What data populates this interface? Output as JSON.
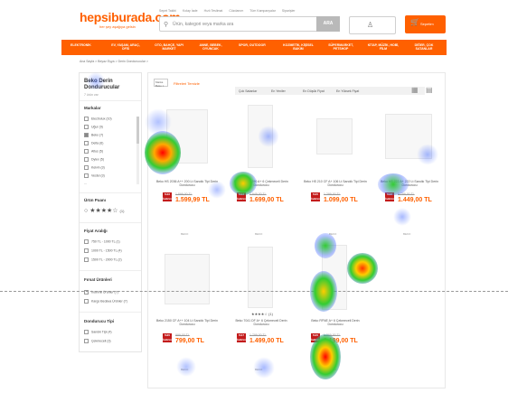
{
  "header": {
    "logo": "hepsiburada.com",
    "slogan": "her şey aşağıya gelsin",
    "top_links": [
      "Sepet Takibi",
      "Kolay İade",
      "Hızlı Teslimat",
      "Cüzdanım",
      "Tüm Kampanyalar",
      "Siparişler"
    ],
    "search_placeholder": "Ürün, kategori veya marka ara",
    "search_button": "ARA",
    "account_icon": "user-icon",
    "cart_label": "Sepetim"
  },
  "categories": [
    "ELEKTRONİK",
    "EV, YAŞAM, ARAÇ, OFİS",
    "OTO, BAHÇE, YAPI MARKET",
    "ANNE, BEBEK, OYUNCAK",
    "SPOR, OUTDOOR",
    "KOZMETİK, KİŞİSEL BAKIM",
    "SÜPERMARKET, PETSHOP",
    "KİTAP, MÜZİK, HOBİ, FİLM",
    "DİĞER, ÇOK SATANLAR"
  ],
  "breadcrumb": "Ana Sayfa > Beyaz Eşya > Derin Dondurucular >",
  "sidebar": {
    "title": "Beko Derin Dondurucular",
    "subtitle": "7 ürün var",
    "brands_title": "Markalar",
    "brands": [
      "Electrolux (10)",
      "Uğur (9)",
      "Beko (7)",
      "Delta (6)",
      "Altus (5)",
      "Dylex (5)",
      "Kelvin (3)",
      "Vestel (3)",
      "..."
    ],
    "rating_title": "Ürün Puanı",
    "rating_stars": "★★★★☆",
    "rating_count": "(1)",
    "price_title": "Fiyat Aralığı",
    "prices": [
      "750 TL - 1000 TL (1)",
      "1000 TL - 1500 TL (4)",
      "1500 TL - 2000 TL (2)"
    ],
    "special_title": "Fırsat Ürünleri",
    "specials": [
      "İndirimli Ürünler (7)",
      "Kargo Bedava Ürünler (7)"
    ],
    "type_title": "Dondurucu Tipi",
    "types": [
      "Sandık Tipi (4)",
      "Çekmeceli (3)"
    ]
  },
  "main": {
    "chip": "Marka Beko",
    "clear_filters": "Filtreleri Temizle",
    "sort": [
      "Çok Satanlar",
      "En Yeniler",
      "En Düşük Fiyat",
      "En Yüksek Fiyat"
    ],
    "products": [
      {
        "brand": "",
        "name": "Beko HS 2036 A++ 200 Lt Sandık Tipi Derin Dondurucu",
        "badge": "%16 İndirim",
        "old": "1.899,00 TL",
        "price": "1.599,99 TL"
      },
      {
        "brand": "",
        "name": "Beko RFNE 290 A+ 6 Çekmeceli Derin Dondurucu",
        "badge": "%13 İndirim",
        "old": "1.949,00 TL",
        "price": "1.699,00 TL"
      },
      {
        "brand": "",
        "name": "Beko HS 210 CF A+ 106 Lt Sandık Tipi Derin Dondurucu",
        "badge": "%15 İndirim",
        "old": "1.299,00 TL",
        "price": "1.099,00 TL"
      },
      {
        "brand": "",
        "name": "Beko HS 222 A+ 222 Lt Sandık Tipi Derin Dondurucu",
        "badge": "%18 İndirim",
        "old": "1.799,00 TL",
        "price": "1.449,00 TL"
      },
      {
        "brand": "",
        "name": "Beko 2150 CF A++ 104 Lt Sandık Tipi Derin Dondurucu",
        "badge": "%20 İndirim",
        "old": "999,00 TL",
        "price": "799,00 TL",
        "rating": ""
      },
      {
        "brand": "",
        "name": "Beko 7041 DF A+ 6 Çekmeceli Derin Dondurucu",
        "badge": "%17 İndirim",
        "old": "1.799,00 TL",
        "price": "1.499,00 TL",
        "rating": "★★★★☆ (1)"
      },
      {
        "brand": "",
        "name": "Beko RFNE A+ 6 Çekmeceli Derin Dondurucu",
        "badge": "%15 İndirim",
        "old": "1.399,00 TL",
        "price": "1.199,00 TL"
      }
    ],
    "brand_caption": "BEKO"
  }
}
